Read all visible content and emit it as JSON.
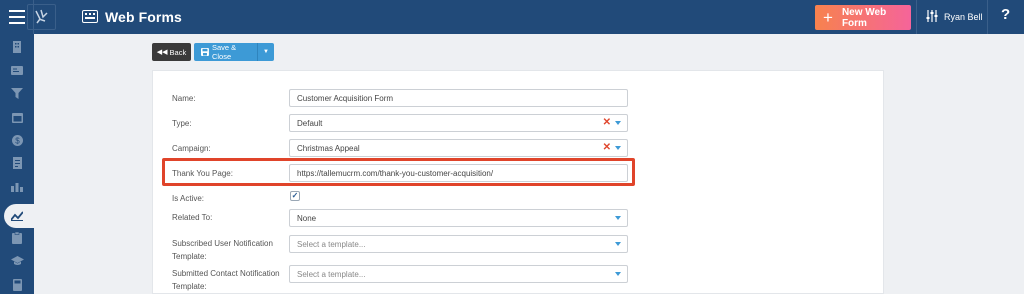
{
  "header": {
    "title": "Web Forms",
    "new_button_label": "New Web Form",
    "user_name": "Ryan Bell",
    "help_label": "?"
  },
  "actions": {
    "back_label": "Back",
    "save_label": "Save & Close"
  },
  "sidebar": {
    "items": [
      "building-icon",
      "id-card-icon",
      "filter-icon",
      "calendar-icon",
      "dollar-icon",
      "document-icon",
      "bar-chart-icon",
      "line-chart-icon",
      "clipboard-icon",
      "graduation-cap-icon",
      "calculator-icon"
    ],
    "active_index": 7
  },
  "form": {
    "name": {
      "label": "Name:",
      "value": "Customer Acquisition Form"
    },
    "type": {
      "label": "Type:",
      "value": "Default"
    },
    "campaign": {
      "label": "Campaign:",
      "value": "Christmas Appeal"
    },
    "thank_you": {
      "label": "Thank You Page:",
      "value": "https://tallemucrm.com/thank-you-customer-acquisition/"
    },
    "is_active": {
      "label": "Is Active:",
      "checked": true
    },
    "related_to": {
      "label": "Related To:",
      "value": "None"
    },
    "subscribed_notification": {
      "label_line1": "Subscribed User Notification",
      "label_line2": "Template:",
      "placeholder": "Select a template..."
    },
    "submitted_notification": {
      "label_line1": "Submitted Contact Notification",
      "label_line2": "Template:",
      "placeholder": "Select a template..."
    }
  },
  "colors": {
    "topbar": "#214a79",
    "accent_blue": "#3d9ad6",
    "highlight_red": "#e0442a",
    "new_button_gradient_start": "#f7824e",
    "new_button_gradient_end": "#f5649a"
  }
}
